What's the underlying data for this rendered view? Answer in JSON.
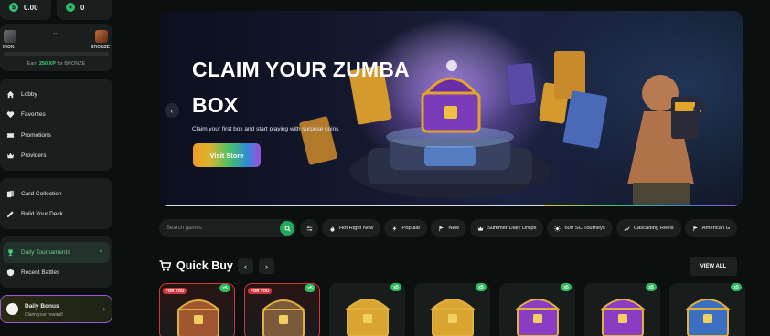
{
  "balance": {
    "gold": "0.00",
    "sweeps": "0",
    "gold_symbol": "$",
    "sweeps_symbol": "●"
  },
  "rank": {
    "current": "IRON",
    "next": "BRONZE",
    "separator": "--",
    "progress": 0.0,
    "earn_prefix": "Earn",
    "earn_xp": "250 XP",
    "earn_suffix": "for BRONZE"
  },
  "nav": {
    "main": [
      {
        "label": "Lobby",
        "icon": "home-icon"
      },
      {
        "label": "Favorites",
        "icon": "heart-icon"
      },
      {
        "label": "Promotions",
        "icon": "ticket-icon"
      },
      {
        "label": "Providers",
        "icon": "crown-icon"
      }
    ],
    "cards": [
      {
        "label": "Card Collection",
        "icon": "cards-icon"
      },
      {
        "label": "Build Your Deck",
        "icon": "pencil-icon"
      }
    ],
    "events": [
      {
        "label": "Daily Tournaments",
        "icon": "trophy-icon",
        "active": true,
        "close": "×"
      },
      {
        "label": "Recent Battles",
        "icon": "shield-icon"
      }
    ]
  },
  "daily_bonus": {
    "title": "Daily Bonus",
    "subtitle": "Claim your reward!",
    "arrow": "›"
  },
  "banner": {
    "title": "CLAIM YOUR ZUMBA BOX",
    "subtitle": "Claim your first box and start playing with surprise coins",
    "cta": "Visit Store",
    "prev": "‹",
    "next": "›",
    "slide_progress": 0.66
  },
  "search": {
    "placeholder": "Search games"
  },
  "filters": [
    {
      "label": "Hot Right Now",
      "icon": "flame-icon"
    },
    {
      "label": "Popular",
      "icon": "bolt-icon"
    },
    {
      "label": "New",
      "icon": "flag-icon"
    },
    {
      "label": "Summer Daily Drops",
      "icon": "crown-icon"
    },
    {
      "label": "600 SC Tourneys",
      "icon": "sun-icon"
    },
    {
      "label": "Cascading Reels",
      "icon": "trend-icon"
    },
    {
      "label": "American G",
      "icon": "flag-icon"
    }
  ],
  "quick_buy": {
    "title": "Quick Buy",
    "prev": "‹",
    "next": "›",
    "view_all": "VIEW ALL",
    "items": [
      {
        "tag": "FOR YOU",
        "multiplier": "x5",
        "chest": "red",
        "color": "#a0562e"
      },
      {
        "tag": "FOR YOU",
        "multiplier": "x5",
        "chest": "green",
        "color": "#7a5a3a"
      },
      {
        "tag": "",
        "multiplier": "x5",
        "chest": "gold",
        "color": "#d9a530"
      },
      {
        "tag": "",
        "multiplier": "x5",
        "chest": "gold",
        "color": "#d9a530"
      },
      {
        "tag": "",
        "multiplier": "x5",
        "chest": "purple",
        "color": "#8a3cc2"
      },
      {
        "tag": "",
        "multiplier": "x5",
        "chest": "purple",
        "color": "#8a3cc2"
      },
      {
        "tag": "",
        "multiplier": "x5",
        "chest": "blue",
        "color": "#3a6fc2"
      }
    ]
  },
  "colors": {
    "accent": "#2fbd5f",
    "sidebar_bg": "#1a1e1d",
    "page_bg": "#0b0f0e",
    "highlight": "#9b5bd6"
  }
}
